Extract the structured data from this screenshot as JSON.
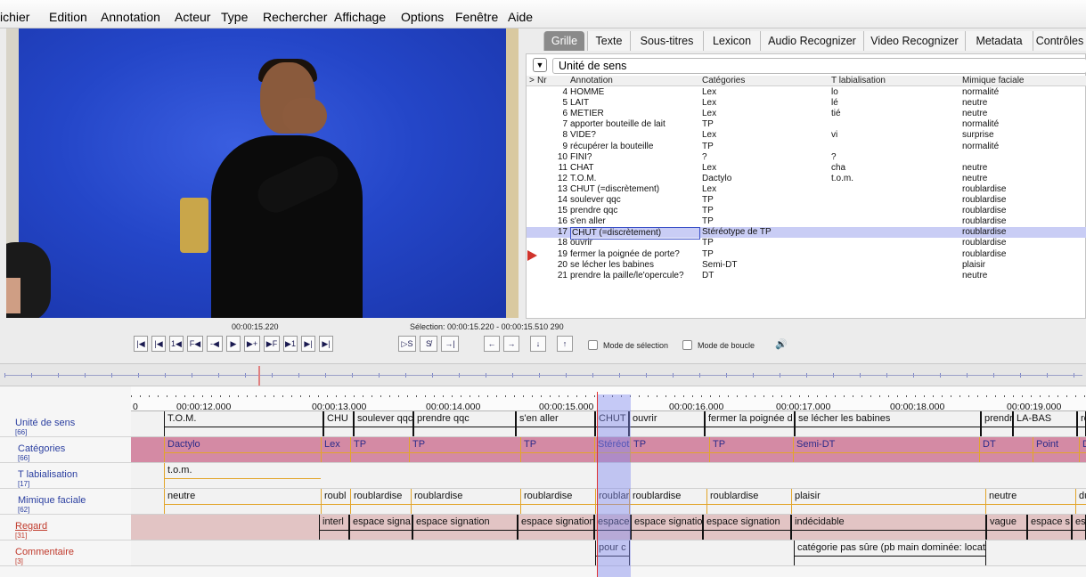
{
  "menubar": {
    "items": [
      "ichier",
      "Edition",
      "Annotation",
      "Acteur",
      "Type",
      "Rechercher",
      "Affichage",
      "Options",
      "Fenêtre",
      "Aide"
    ]
  },
  "tabs": [
    "Grille",
    "Texte",
    "Sous-titres",
    "Lexicon",
    "Audio Recognizer",
    "Video Recognizer",
    "Metadata",
    "Contrôles"
  ],
  "tier_selector": {
    "label": "Unité de sens"
  },
  "grid": {
    "headers": {
      "arrow": ">",
      "nr": "Nr",
      "annotation": "Annotation",
      "categories": "Catégories",
      "tlab": "T labialisation",
      "mimique": "Mimique faciale"
    },
    "rows": [
      {
        "nr": "4",
        "annotation": "HOMME",
        "categories": "Lex",
        "tlab": "lo",
        "mimique": "normalité"
      },
      {
        "nr": "5",
        "annotation": "LAIT",
        "categories": "Lex",
        "tlab": "lé",
        "mimique": "neutre"
      },
      {
        "nr": "6",
        "annotation": "METIER",
        "categories": "Lex",
        "tlab": "tié",
        "mimique": "neutre"
      },
      {
        "nr": "7",
        "annotation": "apporter bouteille de lait",
        "categories": "TP",
        "tlab": "",
        "mimique": "normalité"
      },
      {
        "nr": "8",
        "annotation": "VIDE?",
        "categories": "Lex",
        "tlab": "vi",
        "mimique": "surprise"
      },
      {
        "nr": "9",
        "annotation": "récupérer la bouteille",
        "categories": "TP",
        "tlab": "",
        "mimique": "normalité"
      },
      {
        "nr": "10",
        "annotation": "FINI?",
        "categories": "?",
        "tlab": "?",
        "mimique": ""
      },
      {
        "nr": "11",
        "annotation": "CHAT",
        "categories": "Lex",
        "tlab": "cha",
        "mimique": "neutre"
      },
      {
        "nr": "12",
        "annotation": "T.O.M.",
        "categories": "Dactylo",
        "tlab": "t.o.m.",
        "mimique": "neutre"
      },
      {
        "nr": "13",
        "annotation": "CHUT (=discrètement)",
        "categories": "Lex",
        "tlab": "",
        "mimique": "roublardise"
      },
      {
        "nr": "14",
        "annotation": "soulever qqc",
        "categories": "TP",
        "tlab": "",
        "mimique": "roublardise"
      },
      {
        "nr": "15",
        "annotation": "prendre qqc",
        "categories": "TP",
        "tlab": "",
        "mimique": "roublardise"
      },
      {
        "nr": "16",
        "annotation": "s'en aller",
        "categories": "TP",
        "tlab": "",
        "mimique": "roublardise"
      },
      {
        "nr": "17",
        "annotation": "CHUT (=discrètement)",
        "categories": "Stéréotype de TP",
        "tlab": "",
        "mimique": "roublardise"
      },
      {
        "nr": "18",
        "annotation": "ouvrir",
        "categories": "TP",
        "tlab": "",
        "mimique": "roublardise"
      },
      {
        "nr": "19",
        "annotation": "fermer la poignée de porte?",
        "categories": "TP",
        "tlab": "",
        "mimique": "roublardise"
      },
      {
        "nr": "20",
        "annotation": "se lécher les babines",
        "categories": "Semi-DT",
        "tlab": "",
        "mimique": "plaisir"
      },
      {
        "nr": "21",
        "annotation": "prendre la paille/le'opercule?",
        "categories": "DT",
        "tlab": "",
        "mimique": "neutre"
      }
    ]
  },
  "controls": {
    "time": "00:00:15.220",
    "selection": "Sélection: 00:00:15.220 - 00:00:15.510  290",
    "buttons": [
      "|◀",
      "|◀",
      "1◀",
      "F◀",
      "-◀",
      "▶",
      "▶+",
      "▶F",
      "▶1",
      "▶|",
      "▶|",
      "▷S",
      "S̸",
      "→|",
      "←",
      "→",
      "↓",
      "↑"
    ],
    "mode_selection": "Mode de sélection",
    "mode_boucle": "Mode de boucle",
    "speaker_icon": "🔊"
  },
  "ruler": {
    "labels": [
      "0",
      "00:00:12.000",
      "00:00:13.000",
      "00:00:14.000",
      "00:00:15.000",
      "00:00:16.000",
      "00:00:17.000",
      "00:00:18.000",
      "00:00:19.000"
    ]
  },
  "tiers": [
    {
      "name": "Unité de sens",
      "count": "[66]"
    },
    {
      "name": "Catégories",
      "count": "[66]"
    },
    {
      "name": "T labialisation",
      "count": "[17]"
    },
    {
      "name": "Mimique faciale",
      "count": "[62]"
    },
    {
      "name": "Regard",
      "count": "[31]"
    },
    {
      "name": "Commentaire",
      "count": "[3]"
    }
  ],
  "segments": {
    "unite": [
      "T.O.M.",
      "CHU",
      "soulever qqc",
      "prendre qqc",
      "s'en aller",
      "CHUT",
      "ouvrir",
      "fermer la poignée d",
      "se lécher les babines",
      "prendre l",
      "LA-BAS",
      "re"
    ],
    "categories": [
      "Dactylo",
      "Lex",
      "TP",
      "TP",
      "TP",
      "Stéréot",
      "TP",
      "TP",
      "Semi-DT",
      "DT",
      "Point",
      "DT"
    ],
    "tlab": [
      "t.o.m."
    ],
    "mimique": [
      "neutre",
      "roubl",
      "roublardise",
      "roublardise",
      "roublardise",
      "roublar",
      "roublardise",
      "roublardise",
      "plaisir",
      "neutre",
      "du"
    ],
    "regard": [
      "interl",
      "espace signa",
      "espace signation",
      "espace signation",
      "espace",
      "espace signation",
      "espace signation",
      "indécidable",
      "vague",
      "espace s",
      "es"
    ],
    "commentaire": [
      "pour c",
      "catégorie pas sûre (pb main dominée: locati"
    ]
  },
  "colors": {
    "categories_bg": "#d48aa4",
    "regard_bg": "#e2c4c4",
    "selection": "#8c96f0",
    "cursor": "#e03030",
    "tab_active": "#8a8a8a"
  }
}
